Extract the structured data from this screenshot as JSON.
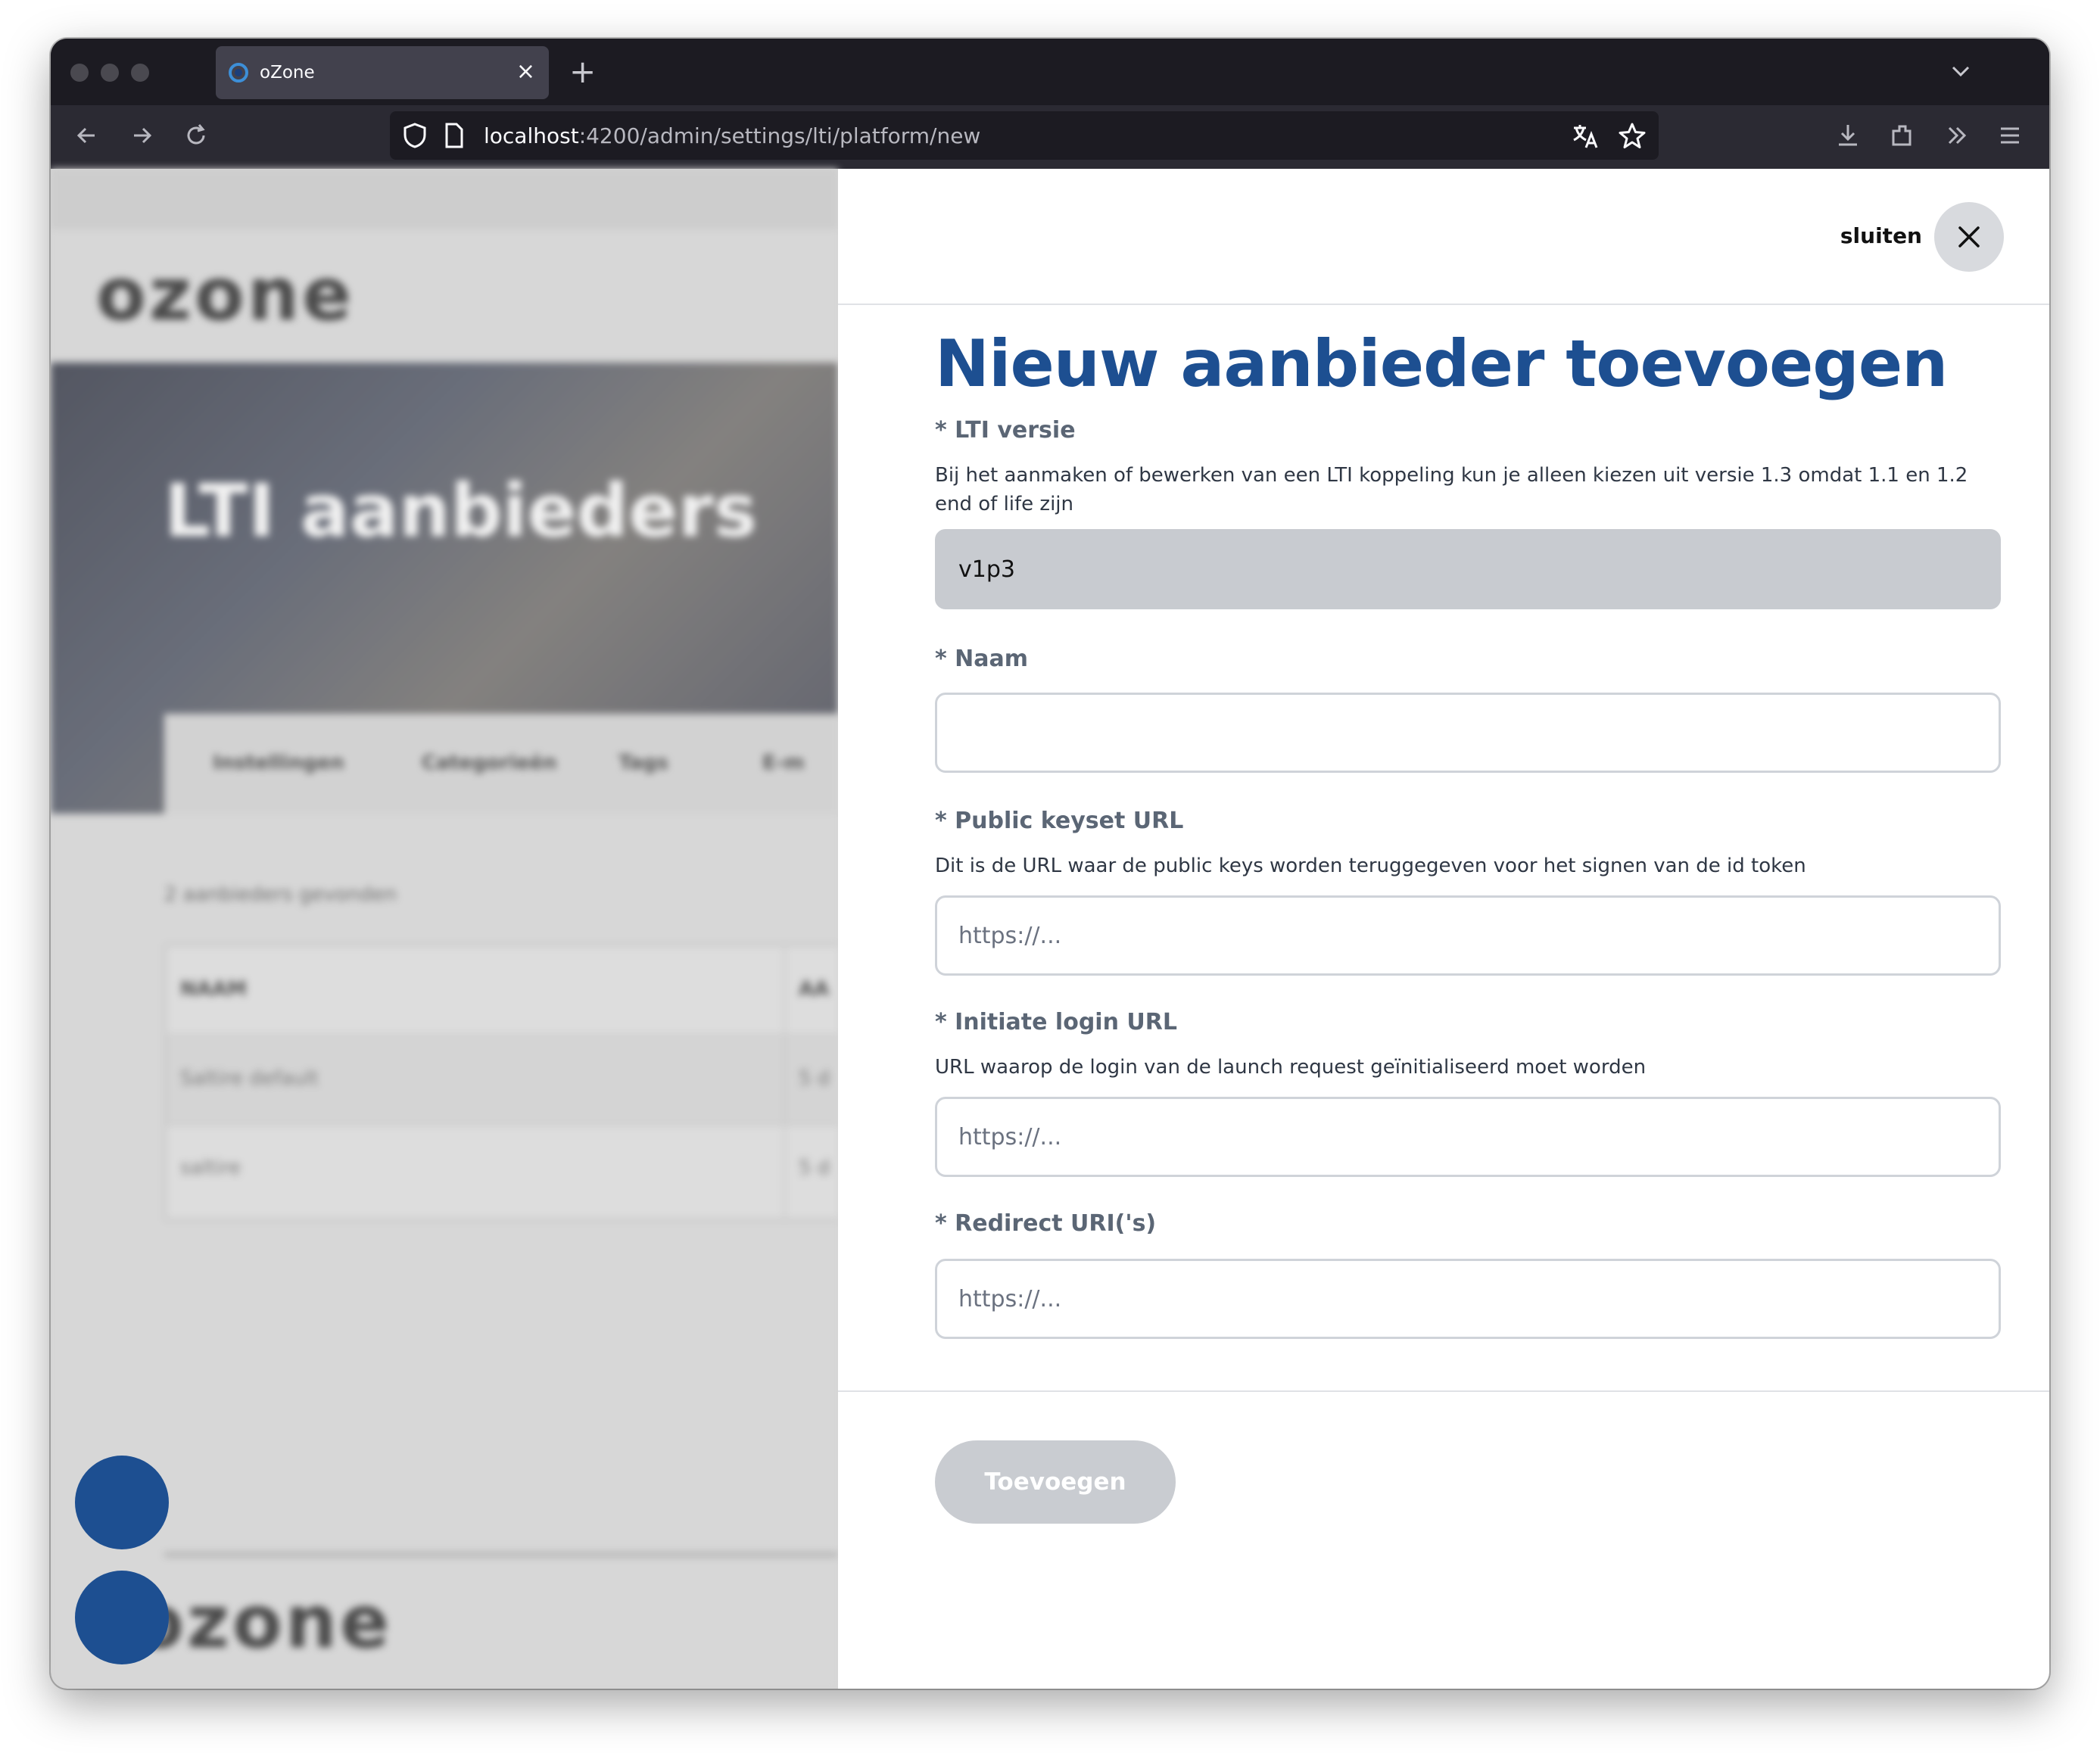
{
  "browser": {
    "tab_title": "oZone",
    "tab_close": "×",
    "new_tab": "+",
    "url_host": "localhost",
    "url_path": ":4200/admin/settings/lti/platform/new"
  },
  "background": {
    "logo": "ozone",
    "hero_title": "LTI aanbieders",
    "tabs": [
      "Instellingen",
      "Categorieën",
      "Tags",
      "E-m"
    ],
    "result_count": "2 aanbieders gevonden",
    "table_header": [
      "NAAM",
      "AA"
    ],
    "rows": [
      [
        "Saltire default",
        "5 d"
      ],
      [
        "saltire",
        "5 d"
      ]
    ],
    "footer_logo": "ozone"
  },
  "panel": {
    "close_label": "sluiten",
    "title": "Nieuw aanbieder toevoegen",
    "lti_version": {
      "label": "* LTI versie",
      "help": "Bij het aanmaken of bewerken van een LTI koppeling kun je alleen kiezen uit versie 1.3 omdat 1.1 en 1.2 end of life zijn",
      "value": "v1p3"
    },
    "name": {
      "label": "* Naam",
      "value": ""
    },
    "public_keyset": {
      "label": "* Public keyset URL",
      "help": "Dit is de URL waar de public keys worden teruggegeven voor het signen van de id token",
      "placeholder": "https://..."
    },
    "initiate_login": {
      "label": "* Initiate login URL",
      "help": "URL waarop de login van de launch request geïnitialiseerd moet worden",
      "placeholder": "https://..."
    },
    "redirect_uris": {
      "label": "* Redirect URI('s)",
      "placeholder": "https://..."
    },
    "submit_label": "Toevoegen"
  },
  "colors": {
    "title": "#1d4f91",
    "label": "#5b6675",
    "submit_disabled": "#c9ccd1"
  }
}
